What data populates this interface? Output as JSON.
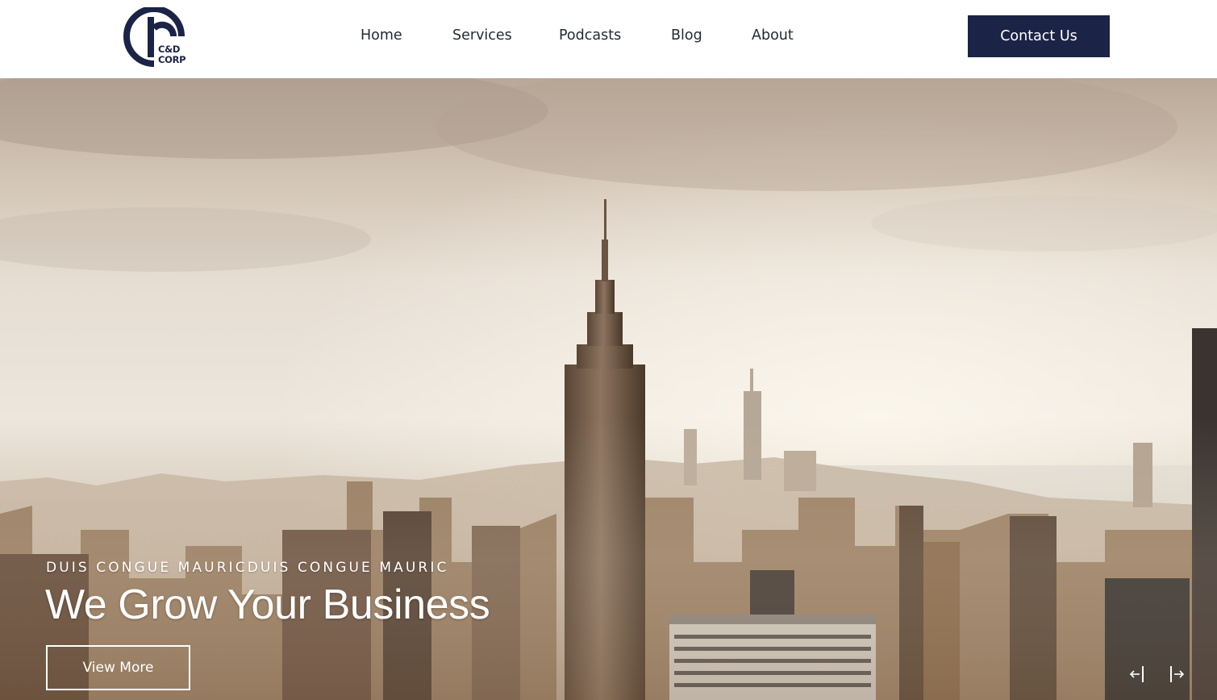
{
  "brand": {
    "logo_line1": "C&D",
    "logo_line2": "CORP",
    "color_primary": "#1b2346"
  },
  "nav": {
    "items": [
      {
        "label": "Home"
      },
      {
        "label": "Services"
      },
      {
        "label": "Podcasts"
      },
      {
        "label": "Blog"
      },
      {
        "label": "About"
      }
    ],
    "contact_label": "Contact Us",
    "contact_bg": "#1b2346"
  },
  "hero": {
    "eyebrow": "DUIS CONGUE MAURICDUIS CONGUE MAURIC",
    "headline": "We Grow Your Business",
    "button_label": "View More",
    "prev_icon": "arrow-left-bar-icon",
    "next_icon": "arrow-right-bar-icon"
  }
}
